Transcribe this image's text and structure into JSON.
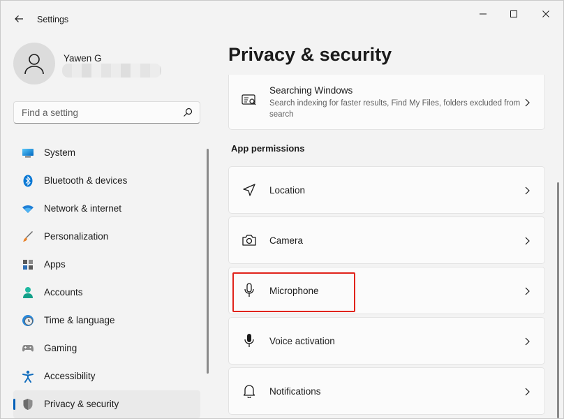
{
  "window": {
    "title": "Settings"
  },
  "profile": {
    "name": "Yawen G"
  },
  "search": {
    "placeholder": "Find a setting"
  },
  "nav": {
    "items": [
      {
        "label": "System",
        "icon": "system-icon"
      },
      {
        "label": "Bluetooth & devices",
        "icon": "bluetooth-icon"
      },
      {
        "label": "Network & internet",
        "icon": "wifi-icon"
      },
      {
        "label": "Personalization",
        "icon": "brush-icon"
      },
      {
        "label": "Apps",
        "icon": "apps-icon"
      },
      {
        "label": "Accounts",
        "icon": "accounts-icon"
      },
      {
        "label": "Time & language",
        "icon": "clock-globe-icon"
      },
      {
        "label": "Gaming",
        "icon": "gamepad-icon"
      },
      {
        "label": "Accessibility",
        "icon": "accessibility-icon"
      },
      {
        "label": "Privacy & security",
        "icon": "shield-icon",
        "selected": true
      }
    ]
  },
  "main": {
    "title": "Privacy & security",
    "searching_windows": {
      "title": "Searching Windows",
      "description": "Search indexing for faster results, Find My Files, folders excluded from search"
    },
    "section_label": "App permissions",
    "permissions": [
      {
        "label": "Location",
        "icon": "location-icon"
      },
      {
        "label": "Camera",
        "icon": "camera-icon"
      },
      {
        "label": "Microphone",
        "icon": "microphone-icon",
        "highlighted": true
      },
      {
        "label": "Voice activation",
        "icon": "voice-activation-icon"
      },
      {
        "label": "Notifications",
        "icon": "bell-icon"
      }
    ]
  },
  "colors": {
    "accent": "#005fb8",
    "highlight": "#e0231b"
  }
}
